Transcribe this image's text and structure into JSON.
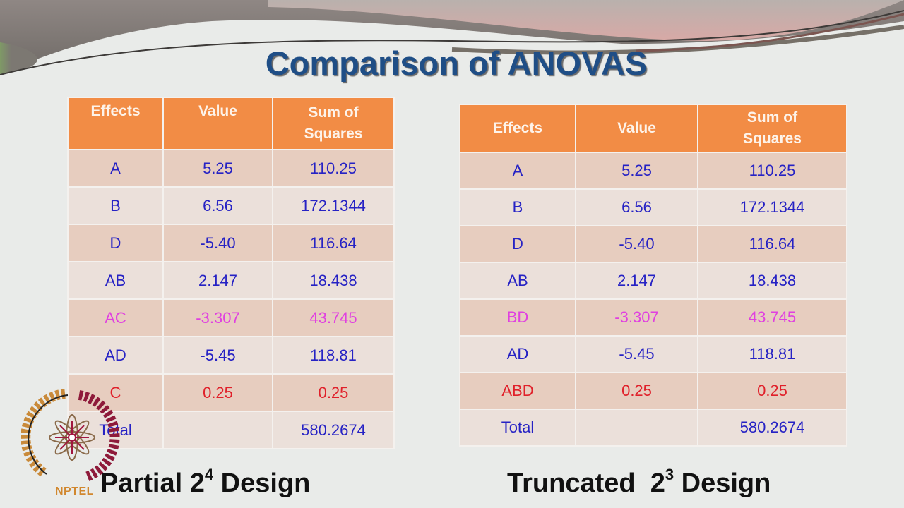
{
  "slide": {
    "title": "Comparison of ANOVAS",
    "colors": {
      "title": "#1f4e86",
      "header_bg": "#f28c45",
      "row_odd": "#e7cdbf",
      "row_even": "#ebe0da",
      "text_blue": "#2622c4",
      "text_magenta": "#e040e0",
      "text_red": "#e0202a"
    }
  },
  "left_table": {
    "headers": [
      "Effects",
      "Value",
      "Sum of Squares"
    ],
    "rows": [
      {
        "effect": "A",
        "value": "5.25",
        "ss": "110.25",
        "color": "blue"
      },
      {
        "effect": "B",
        "value": "6.56",
        "ss": "172.1344",
        "color": "blue"
      },
      {
        "effect": "D",
        "value": "-5.40",
        "ss": "116.64",
        "color": "blue"
      },
      {
        "effect": "AB",
        "value": "2.147",
        "ss": "18.438",
        "color": "blue"
      },
      {
        "effect": "AC",
        "value": "-3.307",
        "ss": "43.745",
        "color": "magenta"
      },
      {
        "effect": "AD",
        "value": "-5.45",
        "ss": "118.81",
        "color": "blue"
      },
      {
        "effect": "C",
        "value": "0.25",
        "ss": "0.25",
        "color": "red"
      },
      {
        "effect": "Total",
        "value": "",
        "ss": "580.2674",
        "color": "blue"
      }
    ],
    "caption": {
      "text": "Partial 2",
      "superscript": "4",
      "suffix": " Design"
    }
  },
  "right_table": {
    "headers": [
      "Effects",
      "Value",
      "Sum of Squares"
    ],
    "rows": [
      {
        "effect": "A",
        "value": "5.25",
        "ss": "110.25",
        "color": "blue"
      },
      {
        "effect": "B",
        "value": "6.56",
        "ss": "172.1344",
        "color": "blue"
      },
      {
        "effect": "D",
        "value": "-5.40",
        "ss": "116.64",
        "color": "blue"
      },
      {
        "effect": "AB",
        "value": "2.147",
        "ss": "18.438",
        "color": "blue"
      },
      {
        "effect": "BD",
        "value": "-3.307",
        "ss": "43.745",
        "color": "magenta"
      },
      {
        "effect": "AD",
        "value": "-5.45",
        "ss": "118.81",
        "color": "blue"
      },
      {
        "effect": "ABD",
        "value": "0.25",
        "ss": "0.25",
        "color": "red"
      },
      {
        "effect": "Total",
        "value": "",
        "ss": "580.2674",
        "color": "blue"
      }
    ],
    "caption": {
      "text": "Truncated  2",
      "superscript": "3",
      "suffix": " Design"
    }
  },
  "logo": {
    "label": "NPTEL"
  }
}
